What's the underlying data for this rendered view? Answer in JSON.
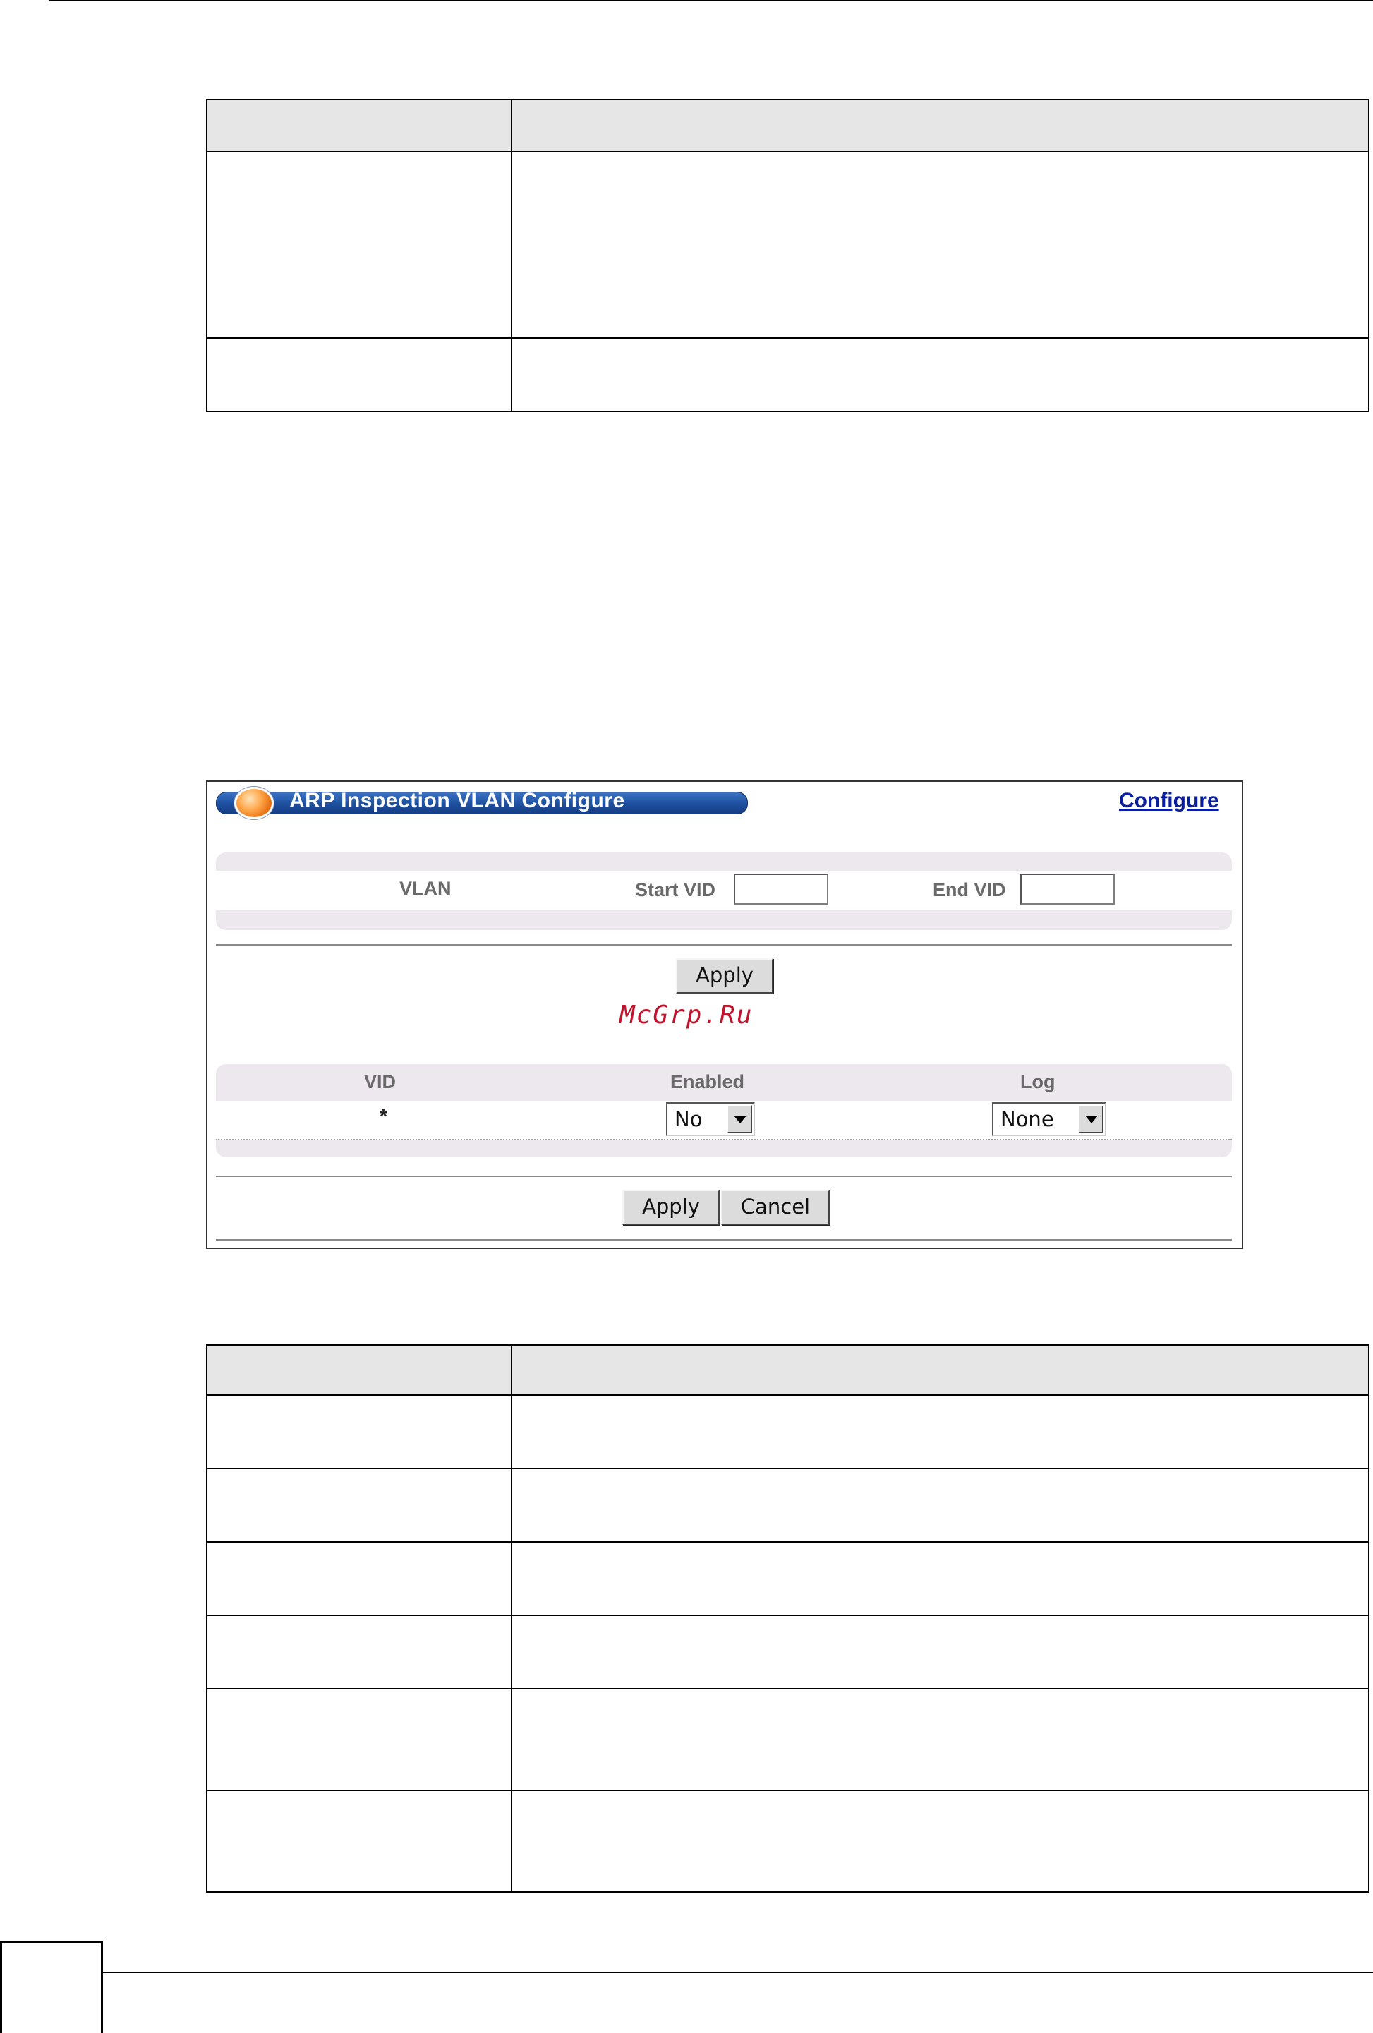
{
  "screen": {
    "title": "ARP Inspection VLAN Configure",
    "configure_link": "Configure",
    "vlan_section": {
      "label": "VLAN",
      "start_vid_label": "Start VID",
      "start_vid_value": "",
      "end_vid_label": "End VID",
      "end_vid_value": ""
    },
    "apply_label": "Apply",
    "table": {
      "headers": [
        "VID",
        "Enabled",
        "Log"
      ],
      "row": {
        "vid": "*",
        "enabled": "No",
        "log": "None"
      }
    },
    "footer_buttons": {
      "apply": "Apply",
      "cancel": "Cancel"
    }
  },
  "watermark": "McGrp.Ru"
}
